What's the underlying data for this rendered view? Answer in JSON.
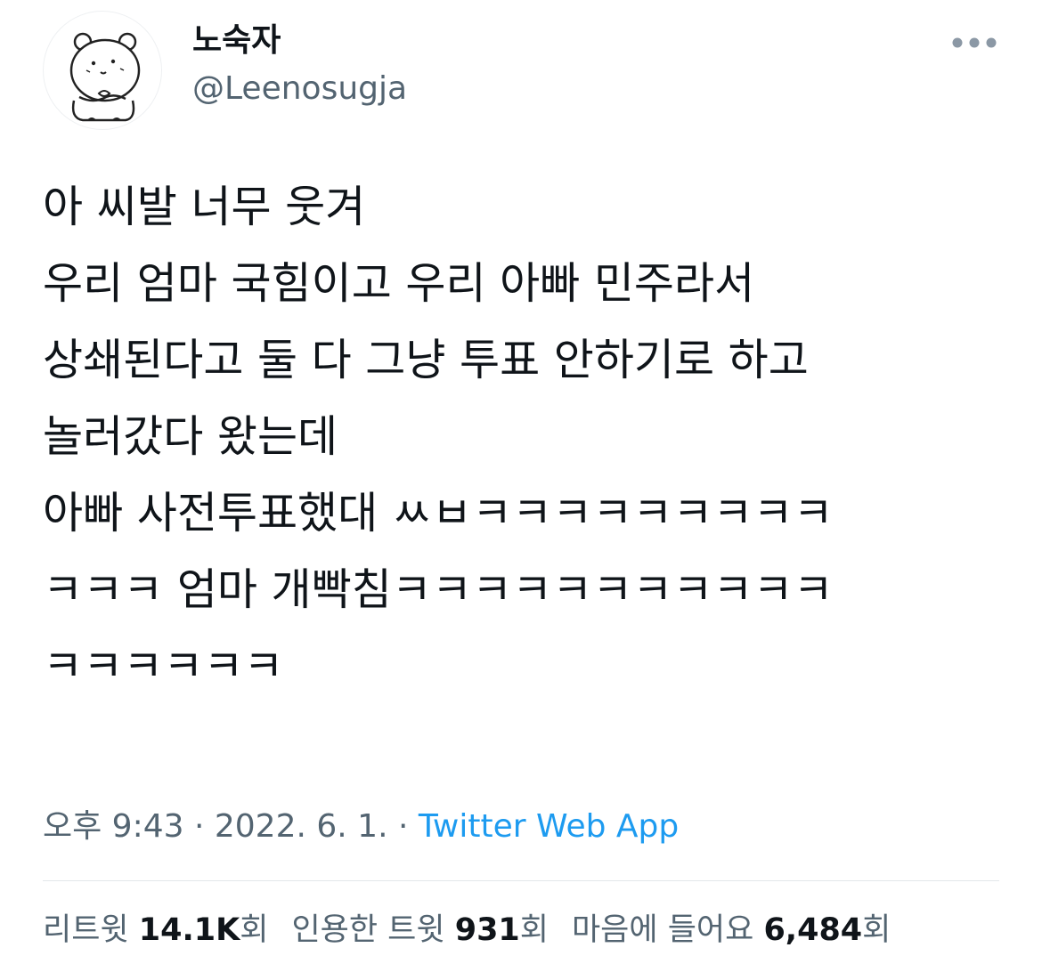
{
  "author": {
    "display_name": "노숙자",
    "handle": "@Leenosugja",
    "avatar_icon": "bear-avatar-icon"
  },
  "more_icon": "more-horizontal-icon",
  "tweet": {
    "lines": [
      "아 씨발 너무 웃겨",
      "우리 엄마 국힘이고 우리 아빠 민주라서",
      "상쇄된다고 둘 다 그냥 투표 안하기로 하고",
      "놀러갔다 왔는데",
      "아빠 사전투표했대 ㅆㅂㅋㅋㅋㅋㅋㅋㅋㅋㅋ",
      "ㅋㅋㅋ 엄마 개빡침ㅋㅋㅋㅋㅋㅋㅋㅋㅋㅋㅋ",
      "ㅋㅋㅋㅋㅋㅋ"
    ]
  },
  "meta": {
    "time": "오후 9:43",
    "sep1": " · ",
    "date": "2022. 6. 1.",
    "sep2": " · ",
    "source": "Twitter Web App"
  },
  "stats": {
    "retweets_label": "리트윗",
    "retweets_value": "14.1K",
    "retweets_suffix": "회",
    "quotes_label": "인용한 트윗",
    "quotes_value": "931",
    "quotes_suffix": "회",
    "likes_label": "마음에 들어요",
    "likes_value": "6,484",
    "likes_suffix": "회"
  },
  "colors": {
    "text": "#0f1419",
    "secondary": "#536471",
    "link": "#1d9bf0",
    "divider": "#e3e7ea"
  }
}
